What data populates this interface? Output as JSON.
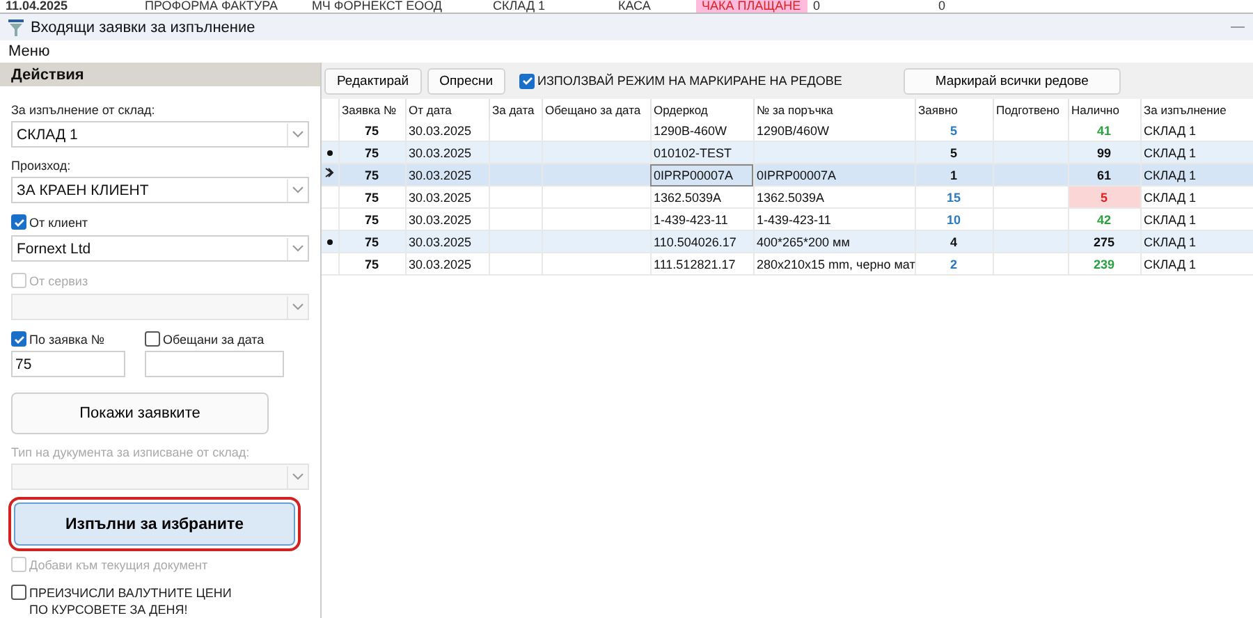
{
  "background_row": [
    "11.04.2025",
    "ПРОФОРМА ФАКТУРА",
    "МЧ ФОРНЕКСТ ЕООД",
    "СКЛАД 1",
    "КАСА",
    "ЧАКА ПЛАЩАНЕ",
    "0",
    "0"
  ],
  "window": {
    "title": "Входящи заявки за изпълнение"
  },
  "menu": [
    "Меню"
  ],
  "actions_panel": {
    "title": "Действия",
    "controls": [
      {
        "kind": "label",
        "text": "За изпълнение от склад:",
        "disabled": false
      },
      {
        "kind": "select",
        "value": "СКЛАД 1",
        "disabled": false
      },
      {
        "kind": "label",
        "text": "Произход:",
        "disabled": false
      },
      {
        "kind": "select",
        "value": "ЗА КРАЕН КЛИЕНТ",
        "disabled": false
      },
      {
        "kind": "checkbox",
        "text": "От клиент",
        "checked": true,
        "disabled": false
      },
      {
        "kind": "select",
        "value": "Fornext Ltd",
        "disabled": false
      },
      {
        "kind": "checkbox",
        "text": "От сервиз",
        "checked": false,
        "disabled": true
      },
      {
        "kind": "select",
        "disabled": true
      },
      {
        "kind": "split",
        "items": [
          {
            "text": "По заявка №",
            "checked": true,
            "value": "75"
          },
          {
            "text": "Обещани за дата",
            "checked": false
          }
        ]
      },
      {
        "kind": "button",
        "text": "Покажи заявките",
        "highlighted": false
      },
      {
        "kind": "label",
        "text": "Тип на дукумента за изписване от склад:",
        "disabled": true
      },
      {
        "kind": "select",
        "disabled": true
      },
      {
        "kind": "button",
        "text": "Изпълни за избраните",
        "highlighted": true
      },
      {
        "kind": "checkbox",
        "text": "Добави към текущия документ",
        "checked": false,
        "disabled": true
      },
      {
        "kind": "checkbox",
        "text": "ПРЕИЗЧИСЛИ ВАЛУТНИТЕ ЦЕНИ\nПО КУРСОВЕТЕ ЗА ДЕНЯ!",
        "checked": false,
        "disabled": false
      }
    ]
  },
  "toolbar": {
    "buttons": [
      "Редактирай",
      "Опресни"
    ],
    "mark_mode": {
      "text": "ИЗПОЛЗВАЙ РЕЖИМ НА МАРКИРАНЕ НА РЕДОВЕ",
      "checked": true
    },
    "mark_all": "Маркирай всички редове"
  },
  "table": {
    "columns": [
      "Заявка №",
      "От дата",
      "За дата",
      "Обещано за дата",
      "Ордеркод",
      "№ за поръчка",
      "Заявно",
      "Подготвено",
      "Налично",
      "За изпълнение"
    ],
    "rows": [
      {
        "request": "75",
        "from_date": "30.03.2025",
        "ordercode": "1290B-460W",
        "order_no": "1290B/460W",
        "requested": "5",
        "available": "41",
        "warehouse": "СКЛАД 1",
        "marked": false,
        "selected": false,
        "short": false
      },
      {
        "request": "75",
        "from_date": "30.03.2025",
        "ordercode": "010102-TEST",
        "requested": "5",
        "available": "99",
        "warehouse": "СКЛАД 1",
        "marked": true,
        "selected": false,
        "short": false
      },
      {
        "request": "75",
        "from_date": "30.03.2025",
        "ordercode": "0IPRP00007A",
        "order_no": "0IPRP00007A",
        "requested": "1",
        "available": "61",
        "warehouse": "СКЛАД 1",
        "marked": false,
        "selected": true,
        "short": false
      },
      {
        "request": "75",
        "from_date": "30.03.2025",
        "ordercode": "1362.5039A",
        "order_no": "1362.5039A",
        "requested": "15",
        "available": "5",
        "warehouse": "СКЛАД 1",
        "marked": false,
        "selected": false,
        "short": true
      },
      {
        "request": "75",
        "from_date": "30.03.2025",
        "ordercode": "1-439-423-11",
        "order_no": "1-439-423-11",
        "requested": "10",
        "available": "42",
        "warehouse": "СКЛАД 1",
        "marked": false,
        "selected": false,
        "short": false
      },
      {
        "request": "75",
        "from_date": "30.03.2025",
        "ordercode": "110.504026.17",
        "order_no": "400*265*200 мм",
        "requested": "4",
        "available": "275",
        "warehouse": "СКЛАД 1",
        "marked": true,
        "selected": false,
        "short": false
      },
      {
        "request": "75",
        "from_date": "30.03.2025",
        "ordercode": "111.512821.17",
        "order_no": "280x210x15 mm, черно мат",
        "requested": "2",
        "available": "239",
        "warehouse": "СКЛАД 1",
        "marked": false,
        "selected": false,
        "short": false
      }
    ]
  }
}
